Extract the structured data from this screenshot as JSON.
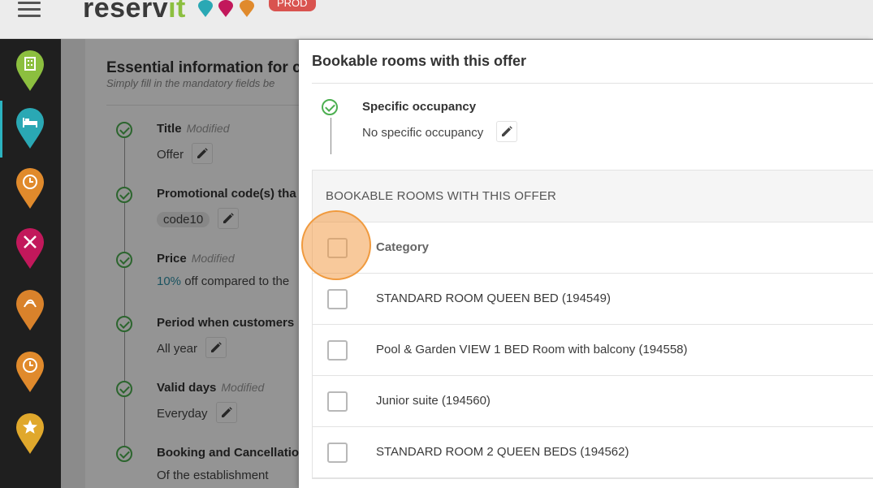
{
  "topbar": {
    "logo_main": "reserv",
    "logo_accent": "it",
    "env_badge": "PROD"
  },
  "rail": {
    "items": [
      {
        "icon": "building-pin-icon",
        "color": "#8cbf3f"
      },
      {
        "icon": "bed-pin-icon",
        "color": "#2aa8b4",
        "active": true
      },
      {
        "icon": "clock-pin-icon",
        "color": "#e08a2c"
      },
      {
        "icon": "restaurant-pin-icon",
        "color": "#c2185b"
      },
      {
        "icon": "spa-pin-icon",
        "color": "#d9822b"
      },
      {
        "icon": "clock-pin-icon",
        "color": "#e08a2c"
      },
      {
        "icon": "star-pin-icon",
        "color": "#e0a82c"
      }
    ]
  },
  "essential": {
    "title": "Essential information for c",
    "subtitle": "Simply fill in the mandatory fields be",
    "items": [
      {
        "label": "Title",
        "modified": "Modified",
        "value": "Offer"
      },
      {
        "label": "Promotional code(s) tha",
        "modified": "",
        "value": "code10"
      },
      {
        "label": "Price",
        "modified": "Modified",
        "value_highlight": "10%",
        "value": " off compared to the"
      },
      {
        "label": "Period when customers",
        "modified": "",
        "value": "All year"
      },
      {
        "label": "Valid days",
        "modified": "Modified",
        "value": "Everyday"
      },
      {
        "label": "Booking and Cancellatio",
        "modified": "",
        "value": "Of the establishment"
      }
    ]
  },
  "panel": {
    "title": "Bookable rooms with this offer",
    "occupancy_label": "Specific occupancy",
    "occupancy_value": "No specific occupancy",
    "table_heading": "BOOKABLE ROOMS WITH THIS OFFER",
    "column_header": "Category",
    "rooms": [
      "STANDARD ROOM QUEEN BED (194549)",
      "Pool & Garden VIEW 1 BED Room with balcony (194558)",
      "Junior suite (194560)",
      "STANDARD ROOM 2 QUEEN BEDS (194562)"
    ]
  }
}
